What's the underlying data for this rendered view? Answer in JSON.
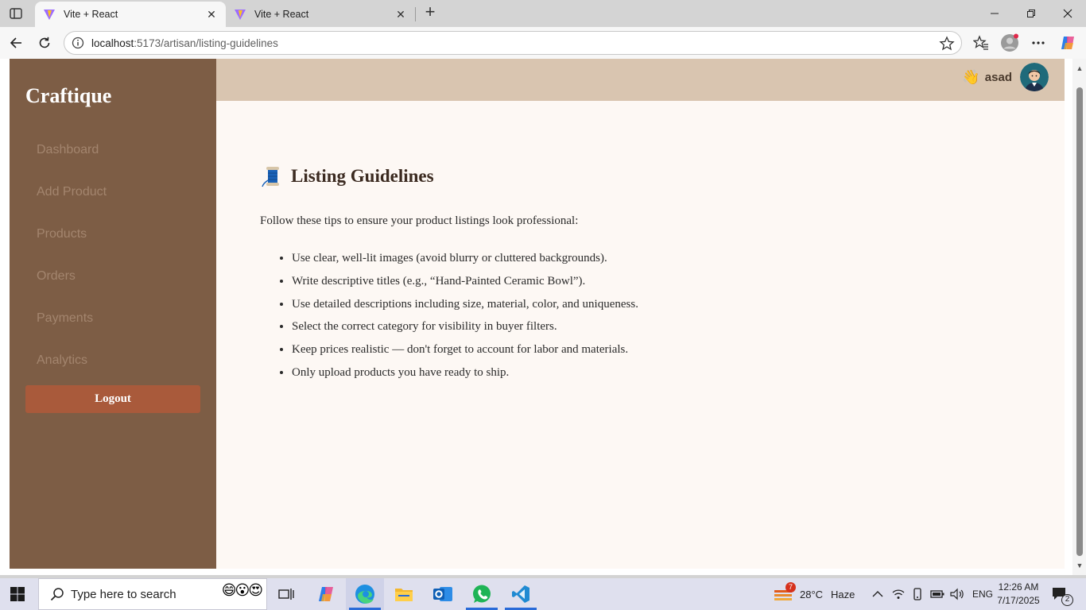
{
  "browser": {
    "tabs": [
      {
        "title": "Vite + React",
        "active": true
      },
      {
        "title": "Vite + React",
        "active": false
      }
    ],
    "url_host": "localhost",
    "url_path": ":5173/artisan/listing-guidelines"
  },
  "sidebar": {
    "brand": "Craftique",
    "items": [
      {
        "label": "Dashboard"
      },
      {
        "label": "Add Product"
      },
      {
        "label": "Products"
      },
      {
        "label": "Orders"
      },
      {
        "label": "Payments"
      },
      {
        "label": "Analytics"
      }
    ],
    "logout_label": "Logout"
  },
  "topbar": {
    "greeting_emoji": "👋",
    "username": "asad"
  },
  "content": {
    "title_emoji": "🧵",
    "title": "Listing Guidelines",
    "intro": "Follow these tips to ensure your product listings look professional:",
    "tips": [
      "Use clear, well-lit images (avoid blurry or cluttered backgrounds).",
      "Write descriptive titles (e.g., “Hand-Painted Ceramic Bowl”).",
      "Use detailed descriptions including size, material, color, and uniqueness.",
      "Select the correct category for visibility in buyer filters.",
      "Keep prices realistic — don't forget to account for labor and materials.",
      "Only upload products you have ready to ship."
    ]
  },
  "taskbar": {
    "search_placeholder": "Type here to search",
    "weather_badge": "7",
    "weather_temp": "28°C",
    "weather_condition": "Haze",
    "language": "ENG",
    "time": "12:26 AM",
    "date": "7/17/2025",
    "notification_count": "2"
  },
  "colors": {
    "sidebar_bg": "#7d5d45",
    "topbar_bg": "#d9c5b0",
    "content_bg": "#fdf8f4",
    "logout_bg": "#a95a3b"
  }
}
